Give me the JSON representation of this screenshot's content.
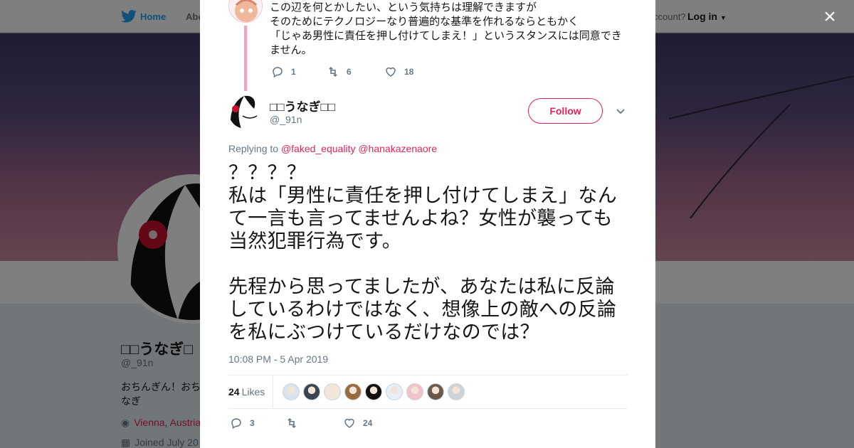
{
  "background": {
    "nav": {
      "home_label": "Home",
      "about_label": "Abo",
      "account_label": "ccount?",
      "login_label": "Log in"
    },
    "profile": {
      "name": "□□うなぎ□",
      "handle": "@_91n",
      "bio": "おちんぎん！おちなぎ",
      "location": "Vienna, Austria",
      "joined": "Joined July 20"
    }
  },
  "close_icon": "×",
  "parent_tweet": {
    "lines": [
      "この辺を何とかしたい、という気持ちは理解できますが",
      "そのためにテクノロジーなり普遍的な基準を作れるならともかく",
      "「じゃあ男性に責任を押し付けてしまえ！」というスタンスには同意できません。"
    ],
    "reply_count": "1",
    "retweet_count": "6",
    "like_count": "18"
  },
  "tweet": {
    "author_name": "□□うなぎ□□",
    "author_handle": "@_91n",
    "follow_label": "Follow",
    "replying_prefix": "Replying to",
    "replying_to": [
      "@faked_equality",
      "@hanakazenaore"
    ],
    "paragraph1": [
      "？？？？",
      "私は「男性に責任を押し付けてしまえ」なんて一言も言ってませんよね？女性が襲っても当然犯罪行為です。"
    ],
    "paragraph2": [
      "先程から思ってましたが、あなたは私に反論しているわけではなく、想像上の敵への反論を私にぶつけているだけなのでは？"
    ],
    "timestamp": "10:08 PM - 5 Apr 2019",
    "likes_number": "24",
    "likes_word": "Likes",
    "reply_count": "3",
    "retweet_count": "",
    "like_count": "24"
  },
  "liker_colors": [
    "#d9e4ec",
    "#3c4450",
    "#f0e6dc",
    "#9a6b42",
    "#111111",
    "#e8eef6",
    "#f3c2c8",
    "#6a5a4c",
    "#cfd3d8"
  ],
  "colors": {
    "accent": "#e0245e",
    "twitter_blue": "#1da1f2",
    "thread_line": "#f59ec4"
  }
}
